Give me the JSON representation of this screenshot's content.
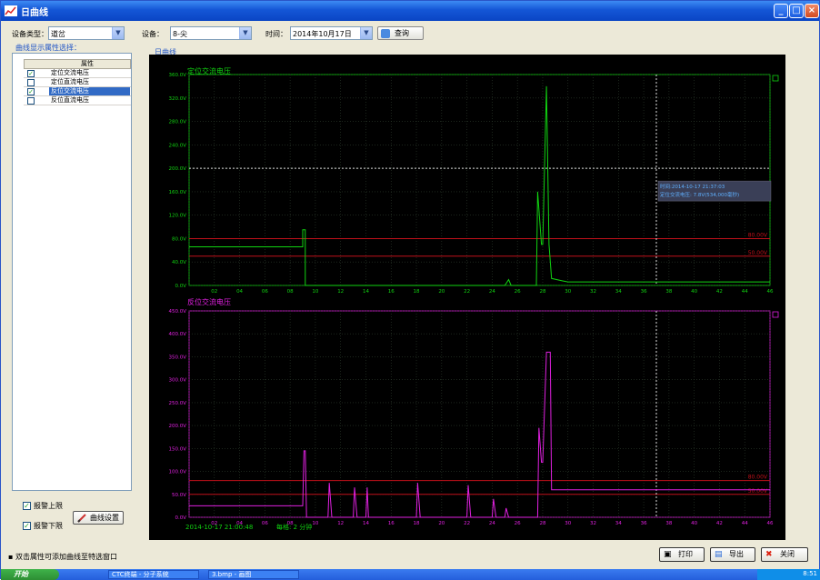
{
  "window": {
    "title": "日曲线"
  },
  "toolbar": {
    "device_type_label": "设备类型：",
    "device_type_value": "道岔",
    "device_label": "设备：",
    "device_value": "8-尖",
    "time_label": "时间：",
    "time_value": "2014年10月17日",
    "query_label": "查询"
  },
  "sidebar": {
    "caption": "曲线显示属性选择：",
    "column_header": "属性",
    "rows": [
      {
        "label": "定位交流电压",
        "checked": true,
        "selected": false
      },
      {
        "label": "定位直流电压",
        "checked": false,
        "selected": false
      },
      {
        "label": "反位交流电压",
        "checked": true,
        "selected": true
      },
      {
        "label": "反位直流电压",
        "checked": false,
        "selected": false
      }
    ],
    "alarm_upper_label": "报警上限",
    "alarm_lower_label": "报警下限",
    "curve_settings_label": "曲线设置"
  },
  "chart_caption": "日曲线",
  "status": {
    "time_text": "2014-10-17 21:00:48",
    "step_text": "每格: 2 分钟",
    "hint": "双击属性可添加曲线至特选窗口"
  },
  "buttons": {
    "print": "打印",
    "export": "导出",
    "close": "关闭"
  },
  "taskbar": {
    "start": "开始",
    "tasks": [
      "CTC终端 - 分子系统",
      "3.bmp - 画图"
    ],
    "clock": "8:51"
  },
  "colors": {
    "green": "#11d411",
    "magenta": "#e020e0",
    "limit": "#c0101a",
    "grid": "#2e3e2e"
  },
  "chart_data": [
    {
      "type": "line",
      "title": "定位交流电压",
      "y_ticks": [
        "0.0V",
        "40.0V",
        "80.0V",
        "120.0V",
        "160.0V",
        "200.0V",
        "240.0V",
        "280.0V",
        "320.0V",
        "360.0V"
      ],
      "ylim": [
        0,
        360
      ],
      "x_ticks": [
        "00",
        "02",
        "04",
        "06",
        "08",
        "10",
        "12",
        "14",
        "16",
        "18",
        "20",
        "22",
        "24",
        "26",
        "28",
        "30",
        "32",
        "34",
        "36",
        "38",
        "40",
        "42",
        "44",
        "46"
      ],
      "xlim": [
        0,
        46
      ],
      "upper_limit": {
        "value": 80,
        "label": "80.00V"
      },
      "lower_limit": {
        "value": 50,
        "label": "50.00V"
      },
      "dotted_level": 200,
      "cursor_x": 37,
      "tooltip": [
        "时间:2014-10-17 21:37:03",
        "定位交流电压: 7.8V(534,000毫秒)"
      ],
      "series": [
        {
          "x": [
            0,
            9,
            9,
            9.2,
            9.2,
            25,
            25.3,
            25.5,
            25.6,
            26,
            27.5,
            27.6,
            27.9,
            28,
            28.3,
            28.5,
            28.7,
            29.5,
            30,
            46
          ],
          "y": [
            66,
            66,
            95,
            95,
            0,
            0,
            10,
            0,
            0,
            0,
            0,
            160,
            70,
            70,
            340,
            70,
            12,
            8,
            6,
            6
          ]
        }
      ]
    },
    {
      "type": "line",
      "title": "反位交流电压",
      "y_ticks": [
        "0.0V",
        "50.0V",
        "100.0V",
        "150.0V",
        "200.0V",
        "250.0V",
        "300.0V",
        "350.0V",
        "400.0V",
        "450.0V"
      ],
      "ylim": [
        0,
        450
      ],
      "x_ticks": [
        "00",
        "02",
        "04",
        "06",
        "08",
        "10",
        "12",
        "14",
        "16",
        "18",
        "20",
        "22",
        "24",
        "26",
        "28",
        "30",
        "32",
        "34",
        "36",
        "38",
        "40",
        "42",
        "44",
        "46"
      ],
      "xlim": [
        0,
        46
      ],
      "upper_limit": {
        "value": 80,
        "label": "80.00V"
      },
      "lower_limit": {
        "value": 50,
        "label": "50.00V"
      },
      "cursor_x": 37,
      "series": [
        {
          "x": [
            0,
            9,
            9.1,
            9.2,
            9.3,
            11,
            11.1,
            11.3,
            13,
            13.1,
            13.3,
            14,
            14.1,
            14.2,
            18,
            18.1,
            18.3,
            22,
            22.1,
            22.3,
            24,
            24.1,
            24.3,
            25,
            25.1,
            25.3,
            27.6,
            27.7,
            27.9,
            28,
            28.3,
            28.6,
            28.7,
            29,
            46
          ],
          "y": [
            25,
            25,
            145,
            145,
            0,
            0,
            75,
            0,
            0,
            65,
            0,
            0,
            65,
            0,
            0,
            75,
            0,
            0,
            70,
            0,
            0,
            40,
            0,
            0,
            20,
            0,
            0,
            195,
            120,
            120,
            360,
            360,
            60,
            60,
            60
          ]
        }
      ]
    }
  ]
}
